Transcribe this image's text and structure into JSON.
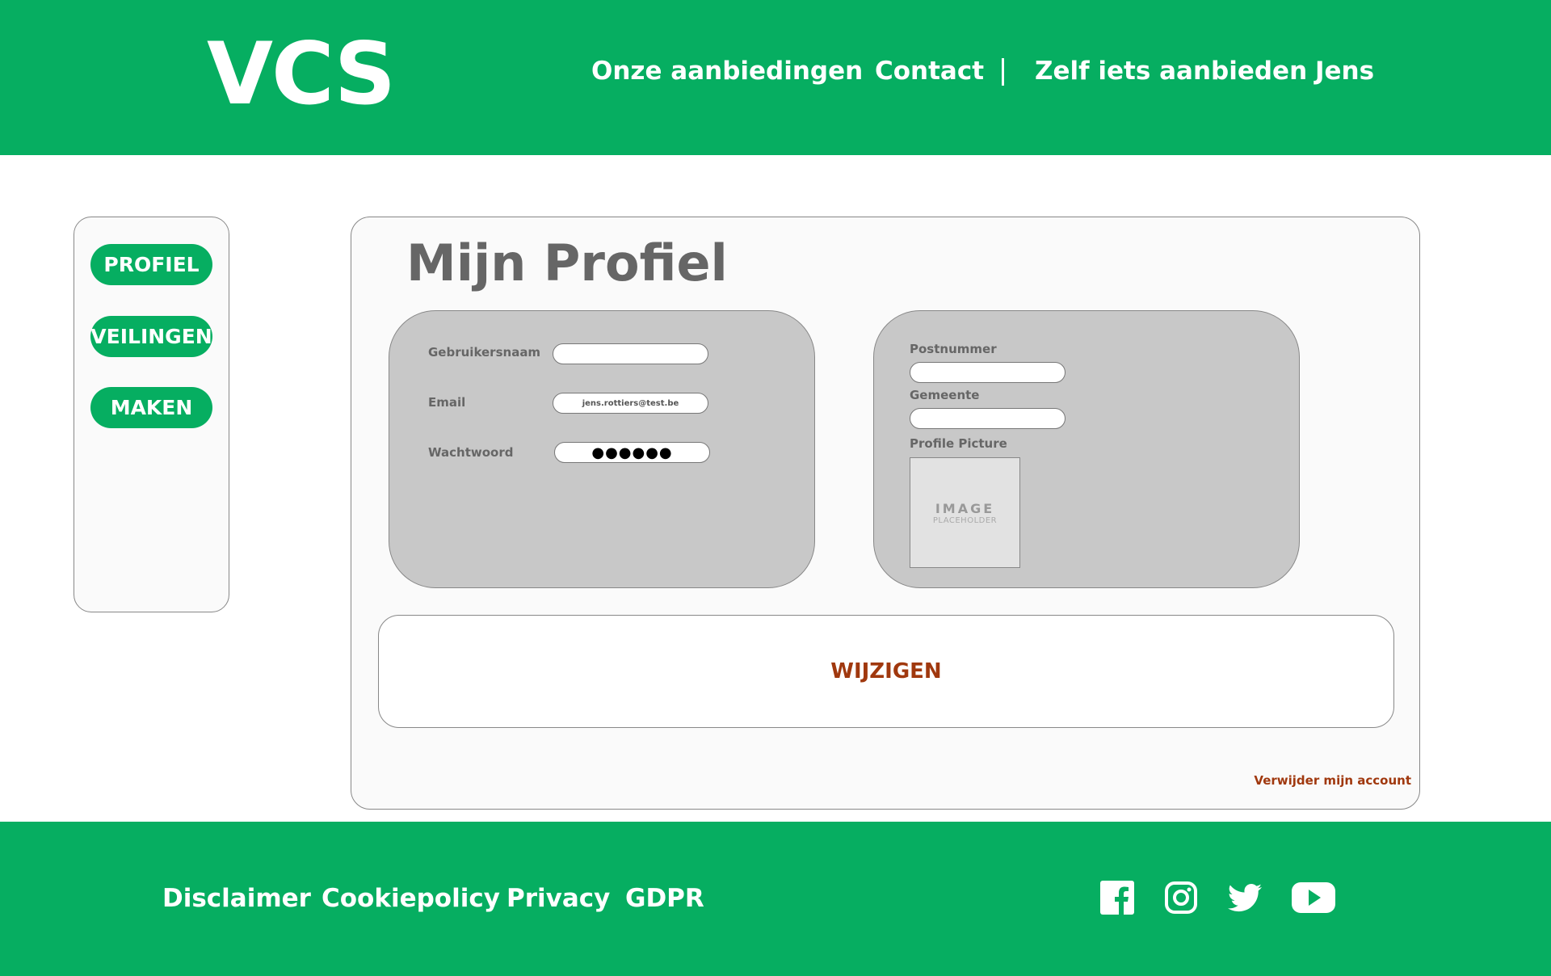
{
  "header": {
    "logo": "VCS",
    "nav": {
      "offers": "Onze aanbiedingen",
      "contact": "Contact",
      "separator": "|",
      "offer_self": "Zelf iets aanbieden",
      "user": "Jens"
    }
  },
  "sidebar": {
    "items": [
      {
        "label": "PROFIEL"
      },
      {
        "label": "VEILINGEN"
      },
      {
        "label": "MAKEN"
      }
    ]
  },
  "main": {
    "title": "Mijn Profiel",
    "left_panel": {
      "username_label": "Gebruikersnaam",
      "username_value": "",
      "email_label": "Email",
      "email_value": "jens.rottiers@test.be",
      "password_label": "Wachtwoord",
      "password_value": "●●●●●●"
    },
    "right_panel": {
      "postcode_label": "Postnummer",
      "postcode_value": "",
      "city_label": "Gemeente",
      "city_value": "",
      "picture_label": "Profile Picture",
      "placeholder_big": "IMAGE",
      "placeholder_small": "PLACEHOLDER"
    },
    "change_button": "WIJZIGEN",
    "delete_link": "Verwijder mijn account"
  },
  "footer": {
    "links": [
      "Disclaimer",
      "Cookiepolicy",
      "Privacy",
      "GDPR"
    ],
    "social_icons": [
      "facebook-icon",
      "instagram-icon",
      "twitter-icon",
      "youtube-icon"
    ]
  },
  "colors": {
    "brand_green": "#06ae61",
    "accent_rust": "#a0380e",
    "panel_gray": "#c8c8c8"
  }
}
